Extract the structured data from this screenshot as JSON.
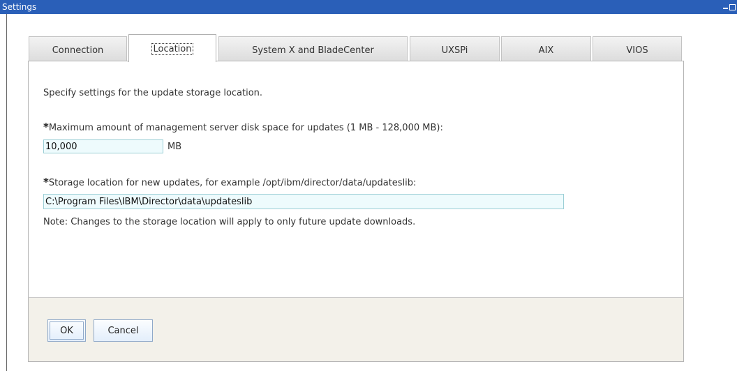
{
  "window": {
    "title": "Settings"
  },
  "tabs": [
    {
      "label": "Connection"
    },
    {
      "label": "Location"
    },
    {
      "label": "System X and BladeCenter"
    },
    {
      "label": "UXSPi"
    },
    {
      "label": "AIX"
    },
    {
      "label": "VIOS"
    }
  ],
  "active_tab": "Location",
  "form": {
    "intro": "Specify settings for the update storage location.",
    "required_marker": "*",
    "disk_space_label": "Maximum amount of management server disk space for updates (1 MB - 128,000 MB):",
    "disk_space_value": "10,000",
    "disk_space_unit": "MB",
    "storage_label": "Storage location for new updates, for example /opt/ibm/director/data/updateslib:",
    "storage_value": "C:\\Program Files\\IBM\\Director\\data\\updateslib",
    "note": "Note: Changes to the storage location will apply to only future update downloads."
  },
  "buttons": {
    "ok": "OK",
    "cancel": "Cancel"
  },
  "colors": {
    "titlebar": "#2a5fb8",
    "input_border": "#9ccfd6",
    "footer_bg": "#f3f1ea"
  }
}
